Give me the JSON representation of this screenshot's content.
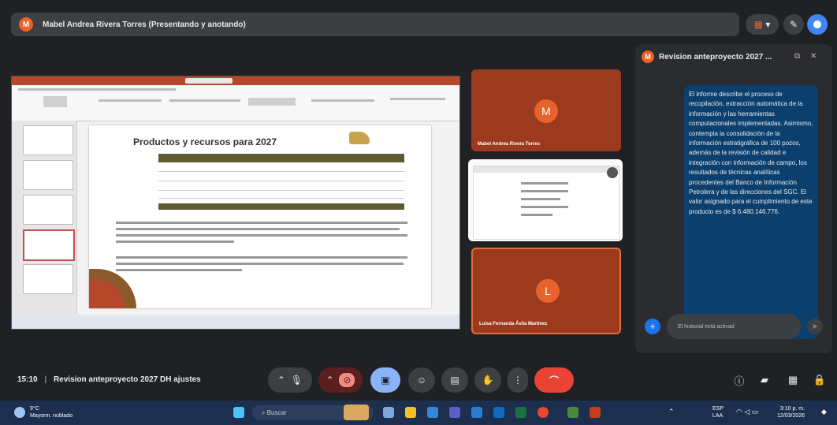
{
  "presenter_bar": {
    "avatar_letter": "M",
    "title": "Mabel Andrea Rivera Torres (Presentando y anotando)"
  },
  "top_right": {
    "layout_icon": "grid-dot-icon",
    "edit_icon": "pen-icon",
    "record_icon": "record-icon"
  },
  "slide": {
    "title": "Productos y recursos para 2027"
  },
  "tiles": [
    {
      "letter": "M",
      "name": "Mabel Andrea Rivera Torres"
    },
    {
      "letter": "",
      "name": ""
    },
    {
      "letter": "L",
      "name": "Luisa Fernanda Ávila Martínez"
    }
  ],
  "chat": {
    "avatar_letter": "M",
    "title": "Revision anteproyecto 2027 ...",
    "message": "El informe describe el proceso de recopilación, extracción automática de la información y las herramientas computacionales implementadas. Asimismo, contempla la consolidación de la información estratigráfica de 100 pozos, además de la revisión de calidad e integración con información de campo, los resultados de técnicas analíticas procedentes del Banco de Información Petrolera y de las direcciones del SGC. El valor asignado para el cumplimiento de este producto es de $ 6.480.146.776.",
    "input_placeholder": "El historial está activad"
  },
  "bottom": {
    "time": "15:10",
    "separator": "|",
    "meeting_title": "Revision anteproyecto 2027 DH ajustes"
  },
  "taskbar": {
    "weather_temp": "9°C",
    "weather_desc": "Mayorm. nublado",
    "search_placeholder": "Buscar",
    "lang": "ESP",
    "lang2": "LAA",
    "clock_time": "3:10 p. m.",
    "clock_date": "12/03/2026"
  },
  "colors": {
    "accent_orange": "#e8632b",
    "tile_bg": "#9b3a1c",
    "chat_bubble": "#0b3f6e",
    "hangup": "#ea4335",
    "primary_blue": "#1a73e8"
  }
}
